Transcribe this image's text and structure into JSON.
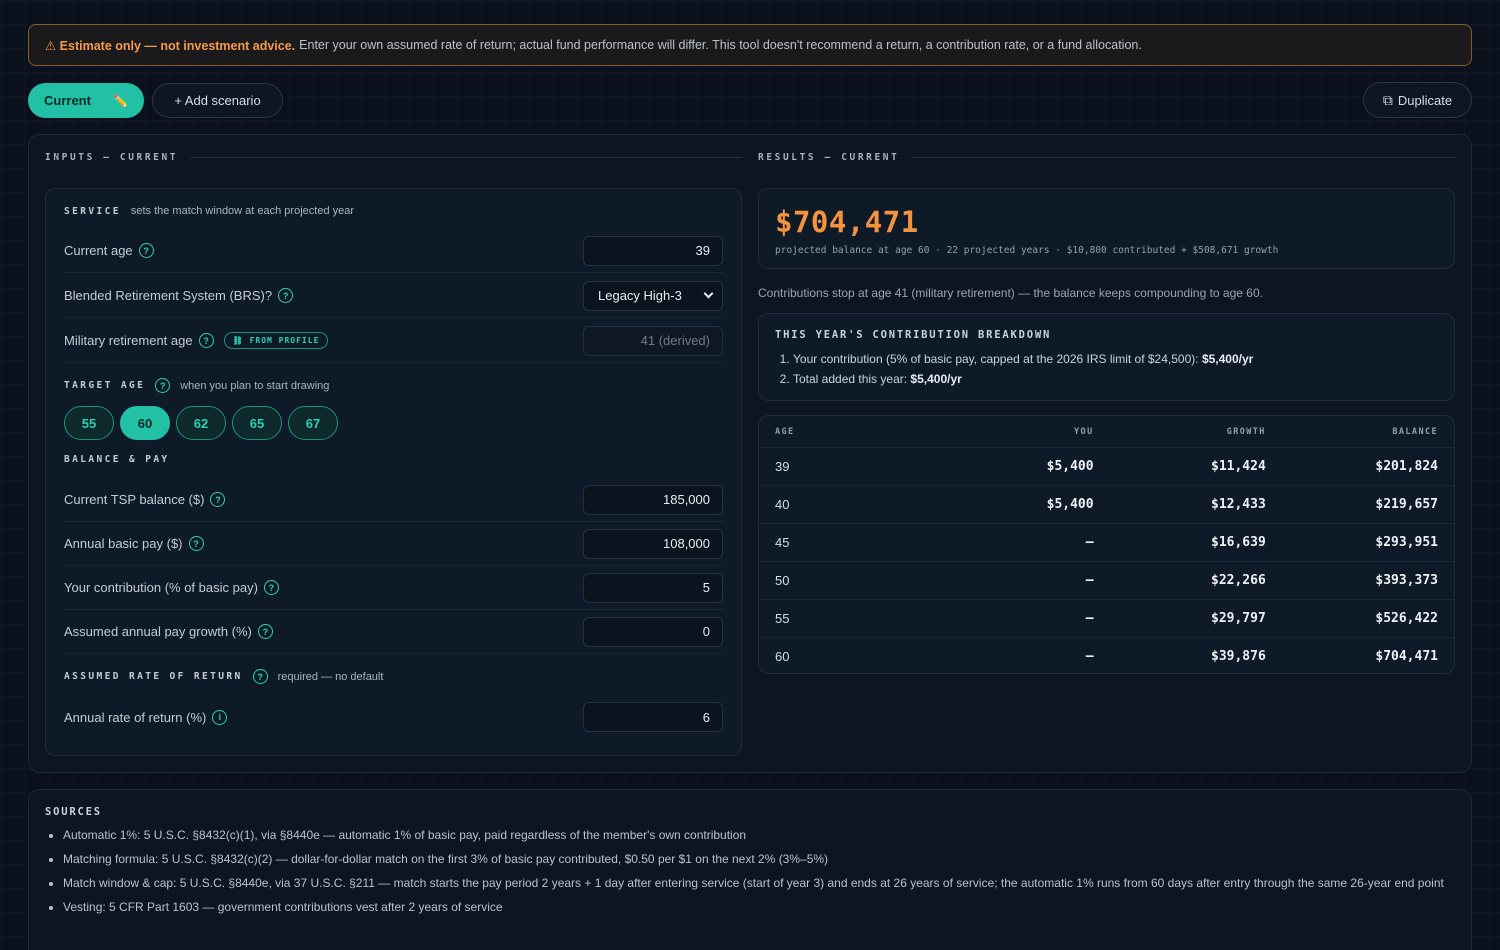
{
  "banner": {
    "warn": "⚠ Estimate only — not investment advice.",
    "text": "Enter your own assumed rate of return; actual fund performance will differ. This tool doesn't recommend a return, a contribution rate, or a fund allocation."
  },
  "scenarios": {
    "current_label": "Current",
    "edit_icon": "✏️",
    "add_label": "+ Add scenario",
    "duplicate_icon": "⧉",
    "duplicate_label": "Duplicate"
  },
  "inputs": {
    "heading": "INPUTS — CURRENT",
    "service_key": "SERVICE",
    "service_desc": "sets the match window at each projected year",
    "current_age_label": "Current age",
    "current_age": "39",
    "brs_label": "Blended Retirement System (BRS)?",
    "brs_value": "Legacy High-3",
    "mil_ret_label": "Military retirement age",
    "from_profile": "⛓ FROM PROFILE",
    "mil_ret_value": "41 (derived)",
    "target_key": "TARGET AGE",
    "target_desc": "when you plan to start drawing",
    "target_ages": [
      "55",
      "60",
      "62",
      "65",
      "67"
    ],
    "target_selected": "60",
    "balance_key": "BALANCE & PAY",
    "tsp_label": "Current TSP balance ($)",
    "tsp_value": "185,000",
    "pay_label": "Annual basic pay ($)",
    "pay_value": "108,000",
    "contrib_label": "Your contribution (% of basic pay)",
    "contrib_value": "5",
    "growth_label": "Assumed annual pay growth (%)",
    "growth_value": "0",
    "return_key": "ASSUMED RATE OF RETURN",
    "return_desc": "required — no default",
    "return_label": "Annual rate of return (%)",
    "return_value": "6"
  },
  "results": {
    "heading": "RESULTS — CURRENT",
    "balance": "$704,471",
    "summary": "projected balance at age 60 · 22 projected years · $10,800 contributed + $508,671 growth",
    "note": "Contributions stop at age 41 (military retirement) — the balance keeps compounding to age 60.",
    "breakdown_title": "THIS YEAR'S CONTRIBUTION BREAKDOWN",
    "breakdown_1_text": "Your contribution (5% of basic pay, capped at the 2026 IRS limit of $24,500):",
    "breakdown_1_value": "$5,400/yr",
    "breakdown_2_text": "Total added this year:",
    "breakdown_2_value": "$5,400/yr",
    "columns": [
      "AGE",
      "YOU",
      "GROWTH",
      "BALANCE"
    ],
    "rows": [
      [
        "39",
        "$5,400",
        "$11,424",
        "$201,824"
      ],
      [
        "40",
        "$5,400",
        "$12,433",
        "$219,657"
      ],
      [
        "45",
        "–",
        "$16,639",
        "$293,951"
      ],
      [
        "50",
        "–",
        "$22,266",
        "$393,373"
      ],
      [
        "55",
        "–",
        "$29,797",
        "$526,422"
      ],
      [
        "60",
        "–",
        "$39,876",
        "$704,471"
      ]
    ]
  },
  "sources": {
    "title": "SOURCES",
    "items": [
      "Automatic 1%: 5 U.S.C. §8432(c)(1), via §8440e — automatic 1% of basic pay, paid regardless of the member's own contribution",
      "Matching formula: 5 U.S.C. §8432(c)(2) — dollar-for-dollar match on the first 3% of basic pay contributed, $0.50 per $1 on the next 2% (3%–5%)",
      "Match window & cap: 5 U.S.C. §8440e, via 37 U.S.C. §211 — match starts the pay period 2 years + 1 day after entering service (start of year 3) and ends at 26 years of service; the automatic 1% runs from 60 days after entry through the same 26-year end point",
      "Vesting: 5 CFR Part 1603 — government contributions vest after 2 years of service"
    ]
  },
  "colors": {
    "accent": "#22c1a6",
    "balance": "#f5923e",
    "warning": "#f59a4a"
  }
}
